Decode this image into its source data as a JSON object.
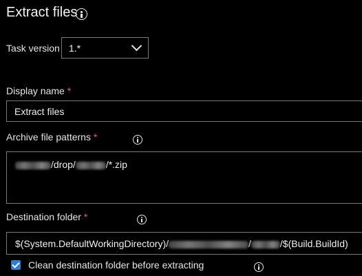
{
  "header": {
    "title": "Extract files",
    "info_icon": "info-icon"
  },
  "task_version": {
    "label": "Task version",
    "value": "1.*",
    "chevron_icon": "chevron-down-icon"
  },
  "display_name": {
    "label": "Display name",
    "required": "*",
    "value": "Extract files"
  },
  "archive_file_patterns": {
    "label": "Archive file patterns",
    "required": "*",
    "value_parts": [
      "/drop/",
      "/*.zip"
    ]
  },
  "destination_folder": {
    "label": "Destination folder",
    "required": "*",
    "value_parts": [
      "$(System.DefaultWorkingDirectory)/",
      "/",
      "/$(Build.BuildId)"
    ]
  },
  "clean_destination": {
    "label": "Clean destination folder before extracting",
    "checked": true
  },
  "colors": {
    "background": "#000000",
    "text": "#f2f2f2",
    "required": "#e0615b",
    "checkbox": "#2f7fd0",
    "border": "#7a7a7a"
  }
}
